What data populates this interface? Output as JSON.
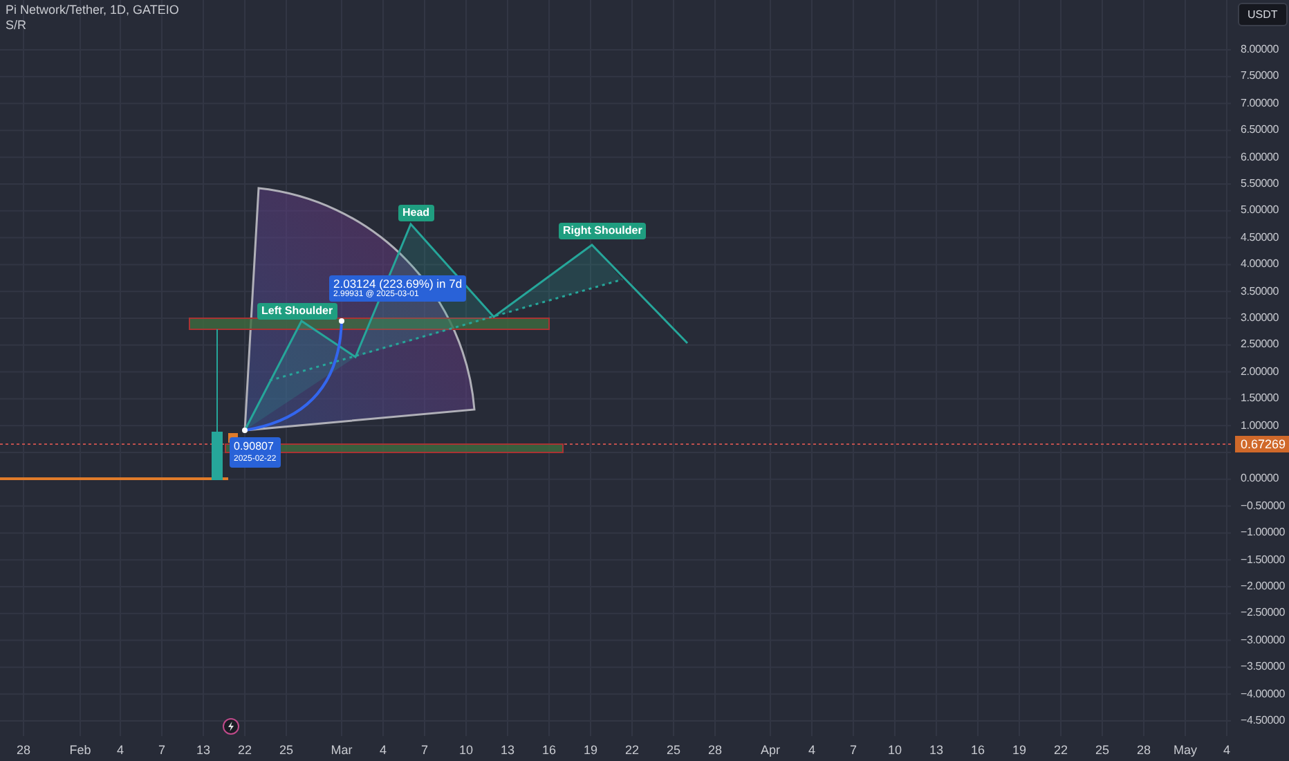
{
  "legend": {
    "title": "Pi Network/Tether, 1D, GATEIO",
    "indicator": "S/R"
  },
  "currency_button": "USDT",
  "price_axis": {
    "labels_upper": [
      "8.00000",
      "7.50000",
      "7.00000",
      "6.50000",
      "6.00000",
      "5.50000",
      "5.00000",
      "4.50000",
      "4.00000",
      "3.50000",
      "3.00000",
      "2.50000",
      "2.00000",
      "1.50000",
      "1.00000"
    ],
    "labels_lower": [
      "0.00000",
      "−0.50000",
      "−1.00000",
      "−1.50000",
      "−2.00000",
      "−2.50000",
      "−3.00000",
      "−3.50000",
      "−4.00000",
      "−4.50000"
    ],
    "last_price": "0.67269"
  },
  "time_axis": {
    "labels": [
      "28",
      "Feb",
      "4",
      "7",
      "13",
      "22",
      "25",
      "Mar",
      "4",
      "7",
      "10",
      "13",
      "16",
      "19",
      "22",
      "25",
      "28",
      "Apr",
      "4",
      "7",
      "10",
      "13",
      "16",
      "19",
      "22",
      "25",
      "28",
      "May",
      "4"
    ]
  },
  "pattern_labels": [
    "Left Shoulder",
    "Head",
    "Right Shoulder"
  ],
  "measure": {
    "change": "2.03124 (223.69%) in 7d",
    "target": "2.99931 @ 2025-03-01"
  },
  "anchor": {
    "price": "0.90807",
    "date": "2025-02-22"
  }
}
